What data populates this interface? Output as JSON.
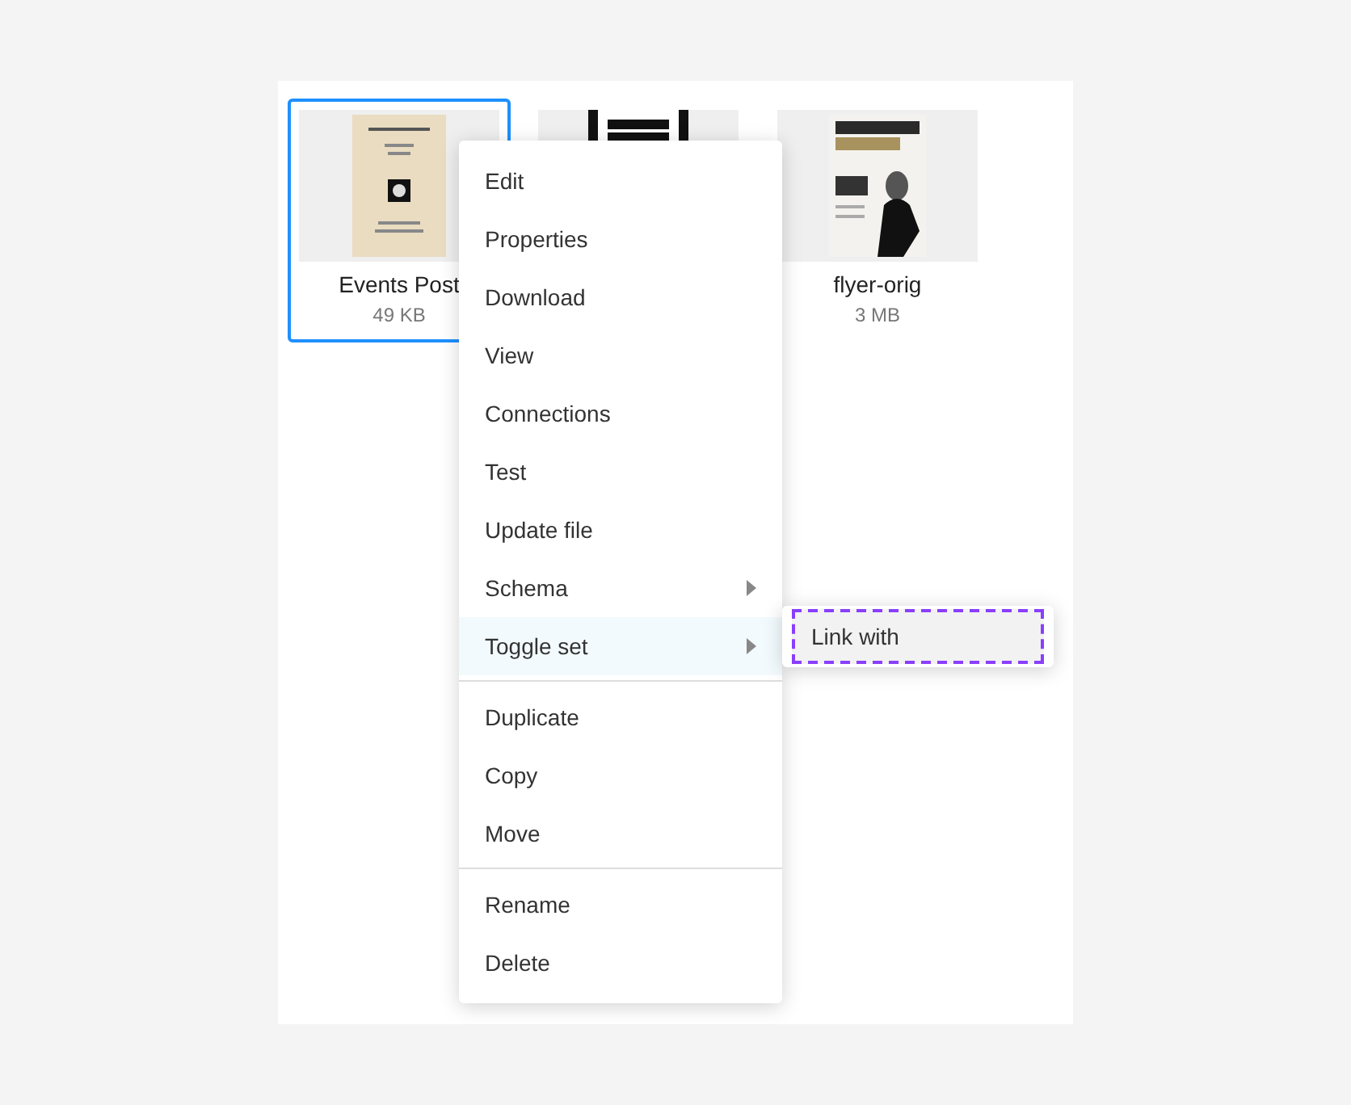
{
  "files": [
    {
      "name": "Events Post",
      "size": "49 KB",
      "selected": true,
      "kind": "picture"
    },
    {
      "selected": false,
      "kind": "picture"
    },
    {
      "name": "flyer-orig",
      "size": "3 MB",
      "selected": false,
      "kind": "picture"
    }
  ],
  "context_menu": {
    "groups": [
      [
        {
          "label": "Edit",
          "has_submenu": false,
          "highlighted": false
        },
        {
          "label": "Properties",
          "has_submenu": false,
          "highlighted": false
        },
        {
          "label": "Download",
          "has_submenu": false,
          "highlighted": false
        },
        {
          "label": "View",
          "has_submenu": false,
          "highlighted": false
        },
        {
          "label": "Connections",
          "has_submenu": false,
          "highlighted": false
        },
        {
          "label": "Test",
          "has_submenu": false,
          "highlighted": false
        },
        {
          "label": "Update file",
          "has_submenu": false,
          "highlighted": false
        },
        {
          "label": "Schema",
          "has_submenu": true,
          "highlighted": false
        },
        {
          "label": "Toggle set",
          "has_submenu": true,
          "highlighted": true
        }
      ],
      [
        {
          "label": "Duplicate",
          "has_submenu": false,
          "highlighted": false
        },
        {
          "label": "Copy",
          "has_submenu": false,
          "highlighted": false
        },
        {
          "label": "Move",
          "has_submenu": false,
          "highlighted": false
        }
      ],
      [
        {
          "label": "Rename",
          "has_submenu": false,
          "highlighted": false
        },
        {
          "label": "Delete",
          "has_submenu": false,
          "highlighted": false
        }
      ]
    ],
    "submenu": [
      {
        "label": "Link with",
        "focused": true
      }
    ]
  }
}
